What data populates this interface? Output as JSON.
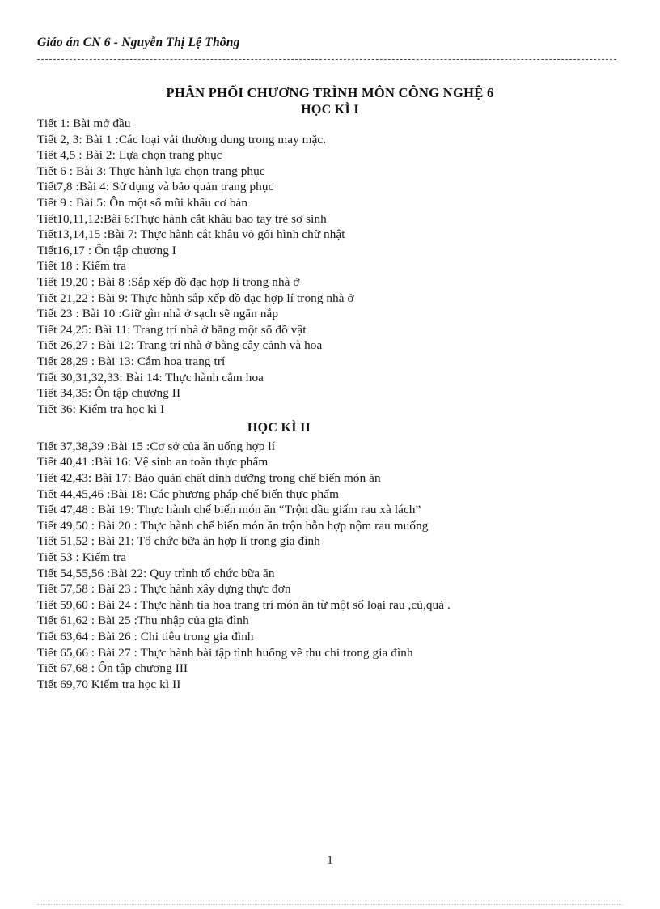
{
  "header": {
    "running_head": "Giáo án CN 6 - Nguyễn Thị Lệ Thông"
  },
  "title": {
    "main": "PHÂN PHỐI CHƯƠNG TRÌNH MÔN CÔNG NGHỆ 6",
    "subtitle": "HỌC KÌ I"
  },
  "term2_heading": "HỌC KÌ II",
  "schedule": {
    "term1": [
      "Tiết 1:  Bài mở đầu",
      "Tiết 2, 3: Bài 1 :Các loại vải  thường  dung  trong may mặc.",
      "Tiết 4,5 : Bài 2: Lựa chọn  trang phục",
      "Tiết 6   : Bài 3: Thực hành  lựa chọn  trang  phục",
      "Tiết7,8 :Bài 4: Sử dụng  và bảo quản trang phục",
      "Tiết 9   : Bài 5: Ôn một số mũi khâu  cơ bản",
      "Tiết10,11,12:Bài  6:Thực  hành  cắt khâu  bao tay trẻ sơ sinh",
      "Tiết13,14,15 :Bài  7: Thực  hành  cắt khâu  vỏ gối  hình  chữ nhật",
      "Tiết16,17 : Ôn tập chương  I",
      "Tiết 18 : Kiểm tra",
      "Tiết 19,20 : Bài 8 :Sắp  xếp đồ đạc hợp lí  trong nhà  ở",
      "Tiết 21,22 : Bài 9: Thực hành  sắp xếp đồ đạc hợp lí trong nhà ở",
      "Tiết 23 : Bài 10 :Giữ  gìn  nhà  ở sạch sẽ ngăn  nắp",
      "Tiết 24,25: Bài 11: Trang trí nhà ở bằng một số đồ vật",
      "Tiết 26,27 : Bài 12: Trang trí nhà ở bằng cây cảnh và hoa",
      "Tiết 28,29 : Bài 13: Cắm hoa trang  trí",
      "Tiết 30,31,32,33: Bài 14: Thực hành  cắm hoa",
      "Tiết 34,35: Ôn tập chương  II",
      "Tiết 36: Kiểm tra học kì I"
    ],
    "term2": [
      "Tiết 37,38,39 :Bài  15 :Cơ sở của ăn uống  hợp lí",
      "Tiết 40,41 :Bài  16: Vệ sinh  an toàn thực phẩm",
      "Tiết 42,43: Bài 17: Bảo quản chất dinh  dưỡng trong chế biến món  ăn",
      "Tiết 44,45,46 :Bài  18: Các phương pháp chế biến thực phẩm",
      "Tiết 47,48 : Bài 19: Thực hành  chế biến món  ăn “Trộn  dầu giấm  rau xà lách”",
      "Tiết 49,50 : Bài 20 : Thực hành  chế biến món  ăn trộn hỗn hợp nộm rau muống",
      "Tiết 51,52 : Bài 21: Tổ chức bữa ăn hợp lí  trong gia đình",
      "Tiết 53 :  Kiểm tra",
      "Tiết 54,55,56 :Bài  22: Quy trình  tổ chức bữa ăn",
      "Tiết 57,58 : Bài 23 : Thực hành  xây dựng thực  đơn",
      "Tiết 59,60 : Bài 24 : Thực hành  tỉa hoa trang trí món  ăn từ một số loại rau ,củ,quả .",
      "Tiết 61,62 : Bài 25 :Thu  nhập của gia đình",
      "Tiết 63,64 : Bài 26 : Chi tiêu trong gia đình",
      "Tiết 65,66 : Bài 27 : Thực hành  bài tập tình  huống  về thu chi trong gia đình",
      "Tiết 67,68 : Ôn tập chương  III",
      "Tiết 69,70 Kiểm tra học kì II"
    ]
  },
  "footer": {
    "page_number": "1"
  }
}
